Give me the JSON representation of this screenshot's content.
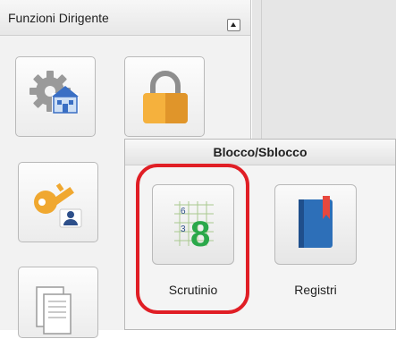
{
  "panel": {
    "title": "Funzioni Dirigente",
    "collapse_icon": "collapse-up-icon"
  },
  "tiles": [
    {
      "name": "settings-school",
      "icon": "gear-school-icon"
    },
    {
      "name": "lock",
      "icon": "padlock-icon"
    },
    {
      "name": "key-user",
      "icon": "key-user-icon"
    },
    {
      "name": "documents",
      "icon": "documents-icon"
    }
  ],
  "popup": {
    "title": "Blocco/Sblocco",
    "items": [
      {
        "label": "Scrutinio",
        "icon": "scrutinio-grid-icon",
        "grid_numbers": [
          "6",
          "3",
          "8"
        ],
        "highlighted": true
      },
      {
        "label": "Registri",
        "icon": "register-book-icon"
      }
    ]
  },
  "colors": {
    "highlight": "#e01e25",
    "padlock": "#f0a830",
    "key": "#f0a830",
    "scrutinio_green": "#2aa84a",
    "book_blue": "#2d6fb8",
    "bookmark_red": "#e8483e"
  }
}
